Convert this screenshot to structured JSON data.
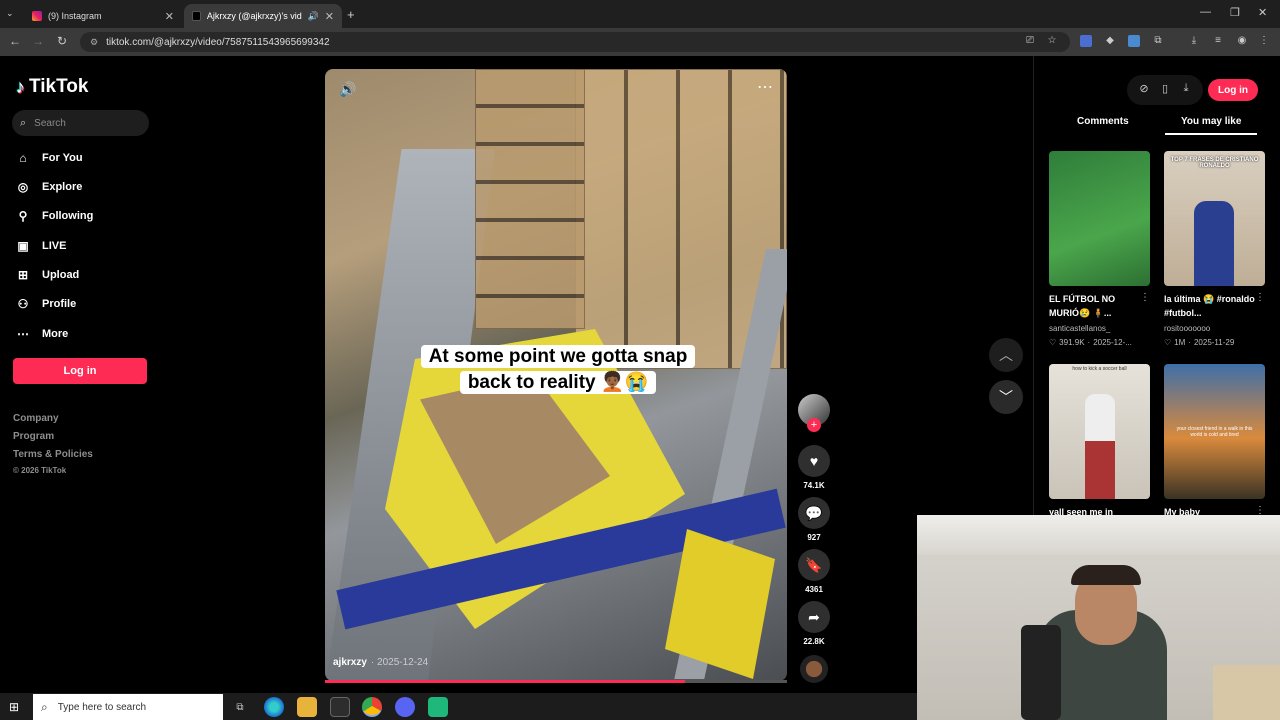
{
  "browser": {
    "tabs": [
      {
        "label": "(9) Instagram",
        "active": false
      },
      {
        "label": "Ajkrxzy (@ajkrxzy)'s videos",
        "active": true
      }
    ],
    "url": "tiktok.com/@ajkrxzy/video/7587511543965699342"
  },
  "sidebar": {
    "logo": "TikTok",
    "search_placeholder": "Search",
    "items": [
      {
        "label": "For You",
        "icon": "home-icon"
      },
      {
        "label": "Explore",
        "icon": "compass-icon"
      },
      {
        "label": "Following",
        "icon": "user-follow-icon"
      },
      {
        "label": "LIVE",
        "icon": "live-icon"
      },
      {
        "label": "Upload",
        "icon": "plus-square-icon"
      },
      {
        "label": "Profile",
        "icon": "user-icon"
      },
      {
        "label": "More",
        "icon": "more-icon"
      }
    ],
    "login": "Log in",
    "footer": [
      "Company",
      "Program",
      "Terms & Policies",
      "© 2026 TikTok"
    ]
  },
  "video": {
    "caption_line1": "At some point we gotta snap",
    "caption_line2": "back to reality 🧑🏾‍🦱😭",
    "author": "ajkrxzy",
    "date": "· 2025-12-24",
    "progress": 0.78
  },
  "actions": {
    "likes": "74.1K",
    "comments": "927",
    "saves": "4361",
    "shares": "22.8K"
  },
  "right_panel": {
    "login": "Log in",
    "tabs": [
      "Comments",
      "You may like"
    ],
    "suggestions": [
      {
        "title": "EL FÚTBOL NO MURIÓ😢 🧍...",
        "author": "santicastellanos_",
        "likes": "391.9K",
        "date": "2025-12-...",
        "thumb_text": ""
      },
      {
        "title": "la última 😭 #ronaldo #futbol...",
        "author": "rositooooooo",
        "likes": "1M",
        "date": "2025-11-29",
        "thumb_text": "TOP 7 FRASES DE CRISTIANO RONALDO"
      },
      {
        "title": "yall seen me in",
        "author": "",
        "likes": "",
        "date": "",
        "thumb_text": "how to kick a soccer ball"
      },
      {
        "title": "My baby",
        "author": "",
        "likes": "",
        "date": "",
        "thumb_text": "your closest friend in a walk in this world is cold and tired"
      }
    ]
  },
  "taskbar": {
    "search_placeholder": "Type here to search"
  },
  "colors": {
    "accent": "#fe2c55",
    "background": "#000000"
  }
}
